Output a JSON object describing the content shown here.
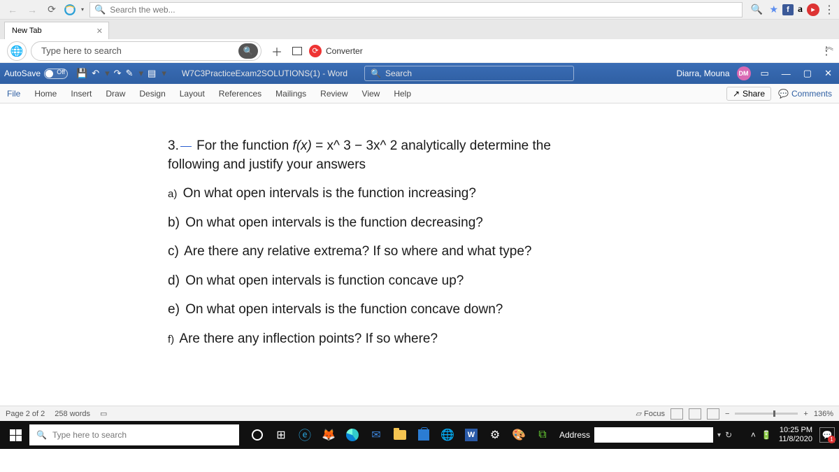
{
  "browser": {
    "search_placeholder": "Search the web...",
    "tab": {
      "title": "New Tab",
      "close": "✕"
    }
  },
  "extbar": {
    "search_text": "Type here to search",
    "converter": "Converter"
  },
  "word": {
    "autosave_label": "AutoSave",
    "autosave_state": "Off",
    "doc_title": "W7C3PracticeExam2SOLUTIONS(1) - Word",
    "search_placeholder": "Search",
    "user_name": "Diarra, Mouna",
    "user_initials": "DM",
    "tabs": [
      "File",
      "Home",
      "Insert",
      "Draw",
      "Design",
      "Layout",
      "References",
      "Mailings",
      "Review",
      "View",
      "Help"
    ],
    "share": "Share",
    "comments": "Comments",
    "status": {
      "page": "Page 2 of 2",
      "words": "258 words",
      "focus": "Focus",
      "zoom": "136%"
    }
  },
  "doc": {
    "q_prefix": "3.",
    "q_line1a": " For the function ",
    "q_fx": "f(x)",
    "q_eq": " = x^ 3 − 3x^ 2 analytically determine the",
    "q_line2": "following and justify your answers",
    "a": "On what open intervals is the function increasing?",
    "b": "On what open intervals is the function decreasing?",
    "c": "Are there any relative extrema? If so where and what type?",
    "d": "On what open intervals is function concave up?",
    "e": "On what open intervals is the function concave down?",
    "f": "Are there any inflection points? If so where?"
  },
  "taskbar": {
    "search_placeholder": "Type here to search",
    "address_label": "Address",
    "time": "10:25 PM",
    "date": "11/8/2020",
    "notif_count": "1"
  }
}
